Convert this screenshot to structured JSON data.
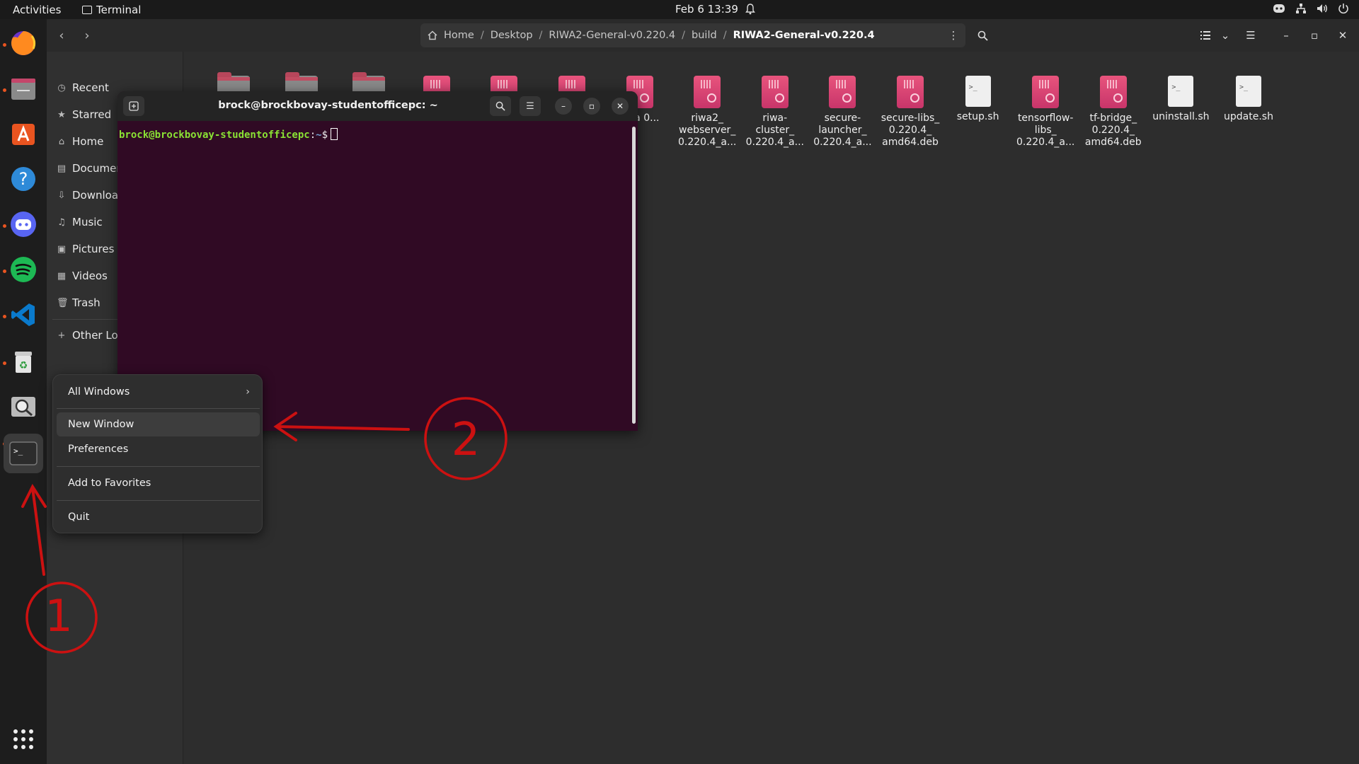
{
  "topbar": {
    "activities": "Activities",
    "app_name": "Terminal",
    "clock": "Feb 6  13:39"
  },
  "files": {
    "path": [
      "Home",
      "Desktop",
      "RIWA2-General-v0.220.4",
      "build",
      "RIWA2-General-v0.220.4"
    ],
    "sidebar": [
      "Recent",
      "Starred",
      "Home",
      "Documen",
      "Downloa",
      "Music",
      "Pictures",
      "Videos",
      "Trash",
      "Other Loc"
    ],
    "items": [
      {
        "name": "",
        "type": "folder"
      },
      {
        "name": "",
        "type": "folder"
      },
      {
        "name": "",
        "type": "folder"
      },
      {
        "name": "",
        "type": "deb"
      },
      {
        "name": "",
        "type": "deb"
      },
      {
        "name": "",
        "type": "deb"
      },
      {
        "name": "nica 0...",
        "type": "deb"
      },
      {
        "name": "riwa2_ webserver_ 0.220.4_a...",
        "type": "deb"
      },
      {
        "name": "riwa- cluster_ 0.220.4_a...",
        "type": "deb"
      },
      {
        "name": "secure- launcher_ 0.220.4_a...",
        "type": "deb"
      },
      {
        "name": "secure-libs_ 0.220.4_ amd64.deb",
        "type": "deb"
      },
      {
        "name": "setup.sh",
        "type": "sh"
      },
      {
        "name": "tensorflow- libs_ 0.220.4_a...",
        "type": "deb"
      },
      {
        "name": "tf-bridge_ 0.220.4_ amd64.deb",
        "type": "deb"
      },
      {
        "name": "uninstall.sh",
        "type": "sh"
      },
      {
        "name": "update.sh",
        "type": "sh"
      }
    ]
  },
  "terminal": {
    "title": "brock@brockbovay-studentofficepc: ~",
    "prompt_user": "brock@brockbovay-studentofficepc",
    "prompt_sep": ":",
    "prompt_path": "~",
    "prompt_symbol": "$"
  },
  "menu": {
    "all_windows": "All Windows",
    "new_window": "New Window",
    "preferences": "Preferences",
    "add_to_favorites": "Add to Favorites",
    "quit": "Quit"
  },
  "annotations": {
    "step1": "1",
    "step2": "2",
    "color": "#cc1111"
  },
  "dock": [
    "firefox-icon",
    "files-icon",
    "app-center-icon",
    "help-icon",
    "discord-icon",
    "spotify-icon",
    "vscode-icon",
    "trash-icon",
    "search-tool-icon",
    "terminal-icon",
    "app-grid-icon"
  ]
}
